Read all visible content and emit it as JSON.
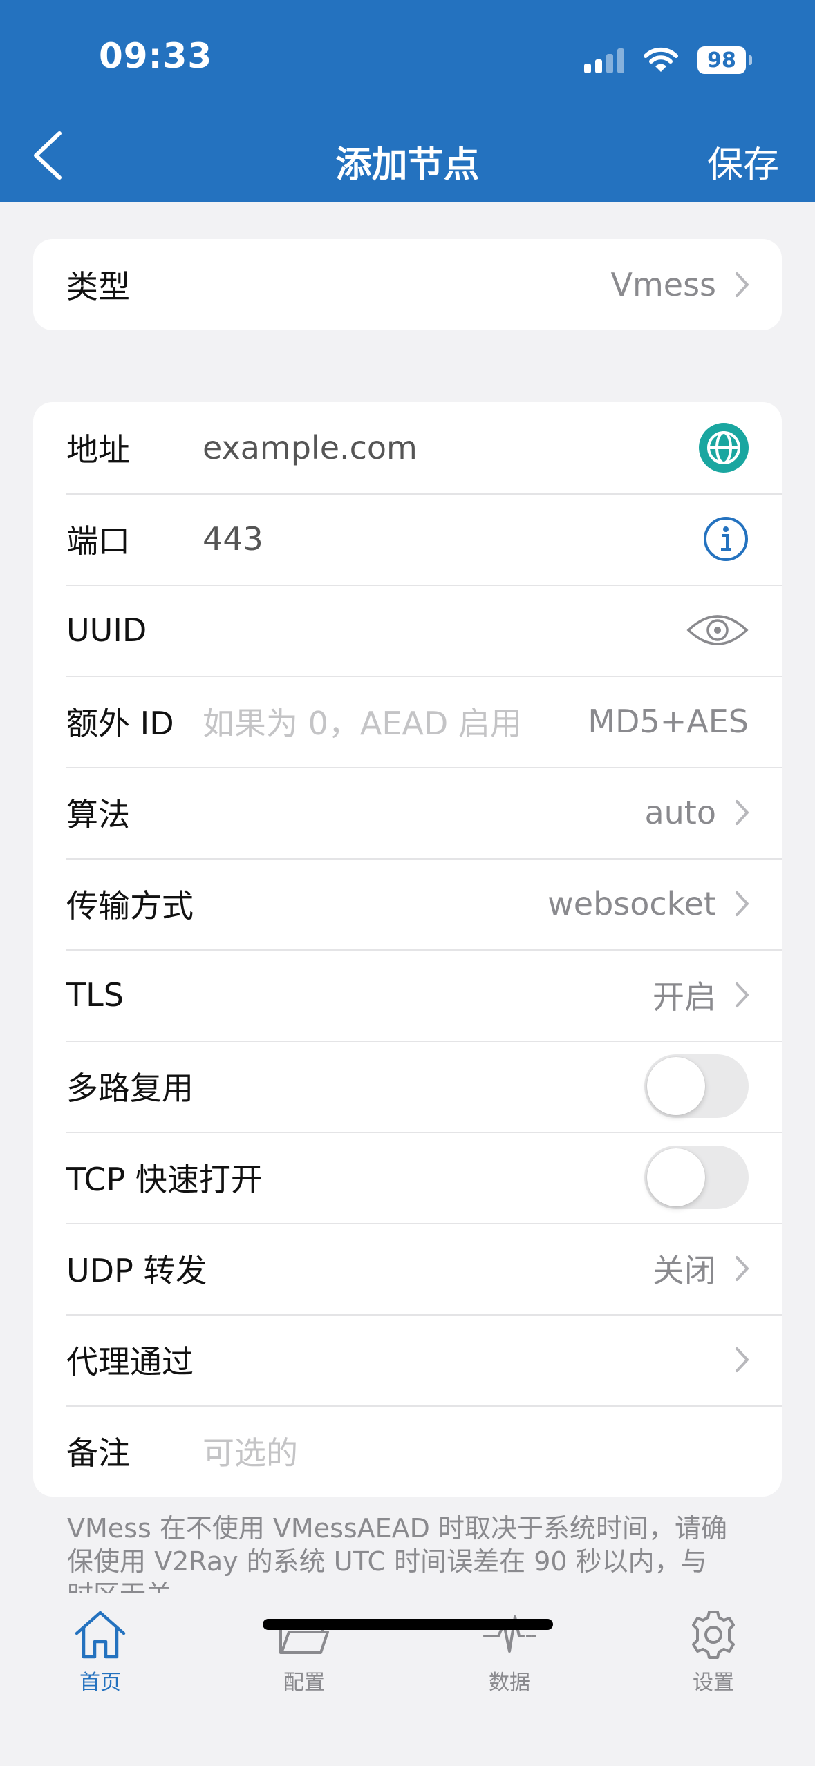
{
  "status_bar": {
    "time": "09:33",
    "battery": "98"
  },
  "nav": {
    "title": "添加节点",
    "save_label": "保存",
    "back_icon": "chevron-left-icon"
  },
  "type_row": {
    "label": "类型",
    "value": "Vmess"
  },
  "form": {
    "address": {
      "label": "地址",
      "value": "example.com",
      "icon": "globe-icon"
    },
    "port": {
      "label": "端口",
      "value": "443",
      "icon": "info-icon"
    },
    "uuid": {
      "label": "UUID",
      "icon": "eye-icon"
    },
    "alter_id": {
      "label": "额外 ID",
      "placeholder": "如果为 0，AEAD 启用",
      "value": "MD5+AES"
    },
    "algorithm": {
      "label": "算法",
      "value": "auto"
    },
    "transport": {
      "label": "传输方式",
      "value": "websocket"
    },
    "tls": {
      "label": "TLS",
      "value": "开启"
    },
    "mux": {
      "label": "多路复用",
      "enabled": false
    },
    "tcp_fast_open": {
      "label": "TCP 快速打开",
      "enabled": false
    },
    "udp_relay": {
      "label": "UDP 转发",
      "value": "关闭"
    },
    "proxy_via": {
      "label": "代理通过"
    },
    "remark": {
      "label": "备注",
      "placeholder": "可选的"
    }
  },
  "footnote": "VMess 在不使用 VMessAEAD 时取决于系统时间，请确保使用 V2Ray 的系统 UTC 时间误差在 90 秒以内，与时区无关。",
  "tabs": [
    {
      "label": "首页",
      "icon": "home-icon",
      "active": true
    },
    {
      "label": "配置",
      "icon": "folder-icon",
      "active": false
    },
    {
      "label": "数据",
      "icon": "activity-icon",
      "active": false
    },
    {
      "label": "设置",
      "icon": "gear-icon",
      "active": false
    }
  ],
  "colors": {
    "accent": "#2472bf",
    "globe": "#1aa6a0",
    "background": "#f2f2f4"
  }
}
